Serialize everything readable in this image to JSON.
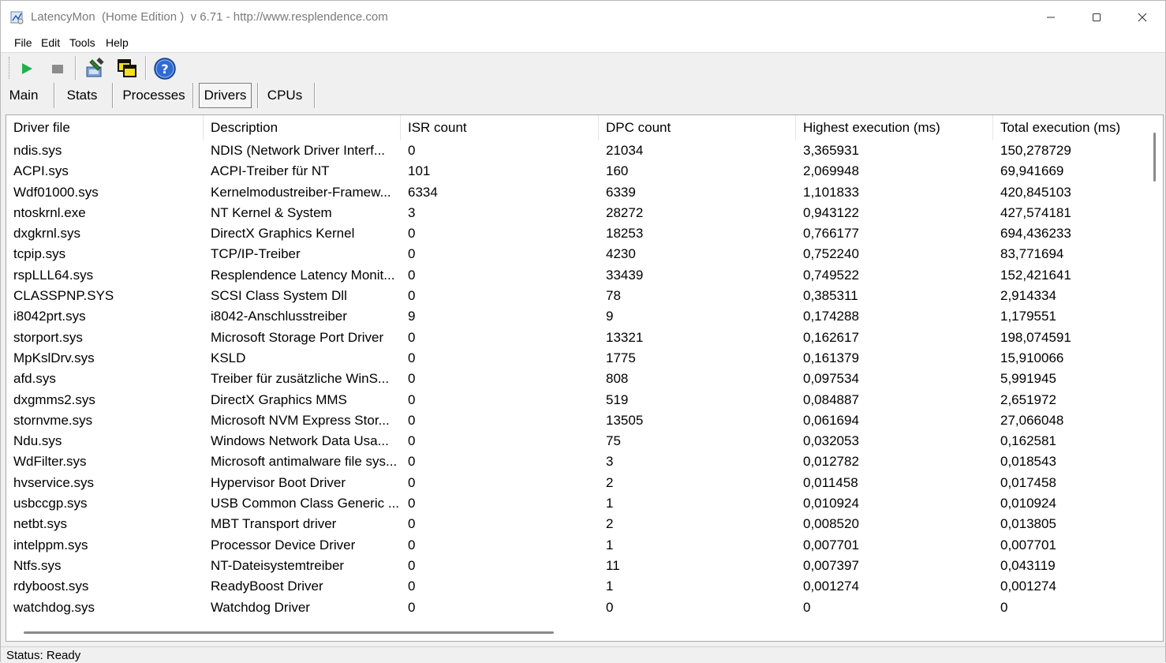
{
  "window": {
    "title": "LatencyMon  (Home Edition )  v 6.71 - http://www.resplendence.com",
    "minimize_icon": "minimize-icon",
    "maximize_icon": "maximize-icon",
    "close_icon": "close-icon"
  },
  "menu": [
    {
      "label": "File"
    },
    {
      "label": "Edit"
    },
    {
      "label": "Tools"
    },
    {
      "label": "Help"
    }
  ],
  "toolbar": {
    "buttons": [
      {
        "name": "start-button",
        "icon": "play-icon",
        "color": "#21b14b"
      },
      {
        "name": "stop-button",
        "icon": "stop-icon",
        "color": "#8c8c8c"
      },
      {
        "name": "drivers-tool-button",
        "icon": "tool-icon"
      },
      {
        "name": "windows-button",
        "icon": "windows-icon"
      },
      {
        "name": "help-button",
        "icon": "help-icon",
        "color": "#2f6bd1"
      }
    ]
  },
  "tabs": [
    {
      "label": "Main",
      "active": false
    },
    {
      "label": "Stats",
      "active": false
    },
    {
      "label": "Processes",
      "active": false
    },
    {
      "label": "Drivers",
      "active": true
    },
    {
      "label": "CPUs",
      "active": false
    }
  ],
  "table": {
    "columns": [
      "Driver file",
      "Description",
      "ISR count",
      "DPC count",
      "Highest execution (ms)",
      "Total execution (ms)"
    ],
    "rows": [
      [
        "ndis.sys",
        "NDIS (Network Driver Interf...",
        "0",
        "21034",
        "3,365931",
        "150,278729"
      ],
      [
        "ACPI.sys",
        "ACPI-Treiber für NT",
        "101",
        "160",
        "2,069948",
        "69,941669"
      ],
      [
        "Wdf01000.sys",
        "Kernelmodustreiber-Framew...",
        "6334",
        "6339",
        "1,101833",
        "420,845103"
      ],
      [
        "ntoskrnl.exe",
        "NT Kernel & System",
        "3",
        "28272",
        "0,943122",
        "427,574181"
      ],
      [
        "dxgkrnl.sys",
        "DirectX Graphics Kernel",
        "0",
        "18253",
        "0,766177",
        "694,436233"
      ],
      [
        "tcpip.sys",
        "TCP/IP-Treiber",
        "0",
        "4230",
        "0,752240",
        "83,771694"
      ],
      [
        "rspLLL64.sys",
        "Resplendence Latency Monit...",
        "0",
        "33439",
        "0,749522",
        "152,421641"
      ],
      [
        "CLASSPNP.SYS",
        "SCSI Class System Dll",
        "0",
        "78",
        "0,385311",
        "2,914334"
      ],
      [
        "i8042prt.sys",
        "i8042-Anschlusstreiber",
        "9",
        "9",
        "0,174288",
        "1,179551"
      ],
      [
        "storport.sys",
        "Microsoft Storage Port Driver",
        "0",
        "13321",
        "0,162617",
        "198,074591"
      ],
      [
        "MpKslDrv.sys",
        "KSLD",
        "0",
        "1775",
        "0,161379",
        "15,910066"
      ],
      [
        "afd.sys",
        "Treiber für zusätzliche WinS...",
        "0",
        "808",
        "0,097534",
        "5,991945"
      ],
      [
        "dxgmms2.sys",
        "DirectX Graphics MMS",
        "0",
        "519",
        "0,084887",
        "2,651972"
      ],
      [
        "stornvme.sys",
        "Microsoft NVM Express Stor...",
        "0",
        "13505",
        "0,061694",
        "27,066048"
      ],
      [
        "Ndu.sys",
        "Windows Network Data Usa...",
        "0",
        "75",
        "0,032053",
        "0,162581"
      ],
      [
        "WdFilter.sys",
        "Microsoft antimalware file sys...",
        "0",
        "3",
        "0,012782",
        "0,018543"
      ],
      [
        "hvservice.sys",
        "Hypervisor Boot Driver",
        "0",
        "2",
        "0,011458",
        "0,017458"
      ],
      [
        "usbccgp.sys",
        "USB Common Class Generic ...",
        "0",
        "1",
        "0,010924",
        "0,010924"
      ],
      [
        "netbt.sys",
        "MBT Transport driver",
        "0",
        "2",
        "0,008520",
        "0,013805"
      ],
      [
        "intelppm.sys",
        "Processor Device Driver",
        "0",
        "1",
        "0,007701",
        "0,007701"
      ],
      [
        "Ntfs.sys",
        "NT-Dateisystemtreiber",
        "0",
        "11",
        "0,007397",
        "0,043119"
      ],
      [
        "rdyboost.sys",
        "ReadyBoost Driver",
        "0",
        "1",
        "0,001274",
        "0,001274"
      ],
      [
        "watchdog.sys",
        "Watchdog Driver",
        "0",
        "0",
        "0",
        "0"
      ]
    ]
  },
  "status": {
    "text": "Status: Ready"
  }
}
